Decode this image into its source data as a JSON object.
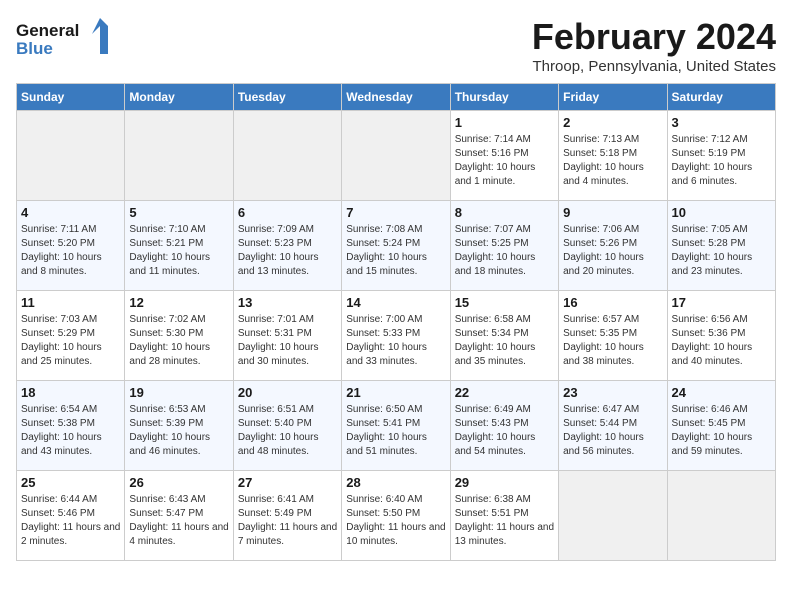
{
  "header": {
    "logo_line1": "General",
    "logo_line2": "Blue",
    "month_title": "February 2024",
    "location": "Throop, Pennsylvania, United States"
  },
  "weekdays": [
    "Sunday",
    "Monday",
    "Tuesday",
    "Wednesday",
    "Thursday",
    "Friday",
    "Saturday"
  ],
  "weeks": [
    [
      {
        "day": "",
        "sunrise": "",
        "sunset": "",
        "daylight": "",
        "empty": true
      },
      {
        "day": "",
        "sunrise": "",
        "sunset": "",
        "daylight": "",
        "empty": true
      },
      {
        "day": "",
        "sunrise": "",
        "sunset": "",
        "daylight": "",
        "empty": true
      },
      {
        "day": "",
        "sunrise": "",
        "sunset": "",
        "daylight": "",
        "empty": true
      },
      {
        "day": "1",
        "sunrise": "Sunrise: 7:14 AM",
        "sunset": "Sunset: 5:16 PM",
        "daylight": "Daylight: 10 hours and 1 minute.",
        "empty": false
      },
      {
        "day": "2",
        "sunrise": "Sunrise: 7:13 AM",
        "sunset": "Sunset: 5:18 PM",
        "daylight": "Daylight: 10 hours and 4 minutes.",
        "empty": false
      },
      {
        "day": "3",
        "sunrise": "Sunrise: 7:12 AM",
        "sunset": "Sunset: 5:19 PM",
        "daylight": "Daylight: 10 hours and 6 minutes.",
        "empty": false
      }
    ],
    [
      {
        "day": "4",
        "sunrise": "Sunrise: 7:11 AM",
        "sunset": "Sunset: 5:20 PM",
        "daylight": "Daylight: 10 hours and 8 minutes.",
        "empty": false
      },
      {
        "day": "5",
        "sunrise": "Sunrise: 7:10 AM",
        "sunset": "Sunset: 5:21 PM",
        "daylight": "Daylight: 10 hours and 11 minutes.",
        "empty": false
      },
      {
        "day": "6",
        "sunrise": "Sunrise: 7:09 AM",
        "sunset": "Sunset: 5:23 PM",
        "daylight": "Daylight: 10 hours and 13 minutes.",
        "empty": false
      },
      {
        "day": "7",
        "sunrise": "Sunrise: 7:08 AM",
        "sunset": "Sunset: 5:24 PM",
        "daylight": "Daylight: 10 hours and 15 minutes.",
        "empty": false
      },
      {
        "day": "8",
        "sunrise": "Sunrise: 7:07 AM",
        "sunset": "Sunset: 5:25 PM",
        "daylight": "Daylight: 10 hours and 18 minutes.",
        "empty": false
      },
      {
        "day": "9",
        "sunrise": "Sunrise: 7:06 AM",
        "sunset": "Sunset: 5:26 PM",
        "daylight": "Daylight: 10 hours and 20 minutes.",
        "empty": false
      },
      {
        "day": "10",
        "sunrise": "Sunrise: 7:05 AM",
        "sunset": "Sunset: 5:28 PM",
        "daylight": "Daylight: 10 hours and 23 minutes.",
        "empty": false
      }
    ],
    [
      {
        "day": "11",
        "sunrise": "Sunrise: 7:03 AM",
        "sunset": "Sunset: 5:29 PM",
        "daylight": "Daylight: 10 hours and 25 minutes.",
        "empty": false
      },
      {
        "day": "12",
        "sunrise": "Sunrise: 7:02 AM",
        "sunset": "Sunset: 5:30 PM",
        "daylight": "Daylight: 10 hours and 28 minutes.",
        "empty": false
      },
      {
        "day": "13",
        "sunrise": "Sunrise: 7:01 AM",
        "sunset": "Sunset: 5:31 PM",
        "daylight": "Daylight: 10 hours and 30 minutes.",
        "empty": false
      },
      {
        "day": "14",
        "sunrise": "Sunrise: 7:00 AM",
        "sunset": "Sunset: 5:33 PM",
        "daylight": "Daylight: 10 hours and 33 minutes.",
        "empty": false
      },
      {
        "day": "15",
        "sunrise": "Sunrise: 6:58 AM",
        "sunset": "Sunset: 5:34 PM",
        "daylight": "Daylight: 10 hours and 35 minutes.",
        "empty": false
      },
      {
        "day": "16",
        "sunrise": "Sunrise: 6:57 AM",
        "sunset": "Sunset: 5:35 PM",
        "daylight": "Daylight: 10 hours and 38 minutes.",
        "empty": false
      },
      {
        "day": "17",
        "sunrise": "Sunrise: 6:56 AM",
        "sunset": "Sunset: 5:36 PM",
        "daylight": "Daylight: 10 hours and 40 minutes.",
        "empty": false
      }
    ],
    [
      {
        "day": "18",
        "sunrise": "Sunrise: 6:54 AM",
        "sunset": "Sunset: 5:38 PM",
        "daylight": "Daylight: 10 hours and 43 minutes.",
        "empty": false
      },
      {
        "day": "19",
        "sunrise": "Sunrise: 6:53 AM",
        "sunset": "Sunset: 5:39 PM",
        "daylight": "Daylight: 10 hours and 46 minutes.",
        "empty": false
      },
      {
        "day": "20",
        "sunrise": "Sunrise: 6:51 AM",
        "sunset": "Sunset: 5:40 PM",
        "daylight": "Daylight: 10 hours and 48 minutes.",
        "empty": false
      },
      {
        "day": "21",
        "sunrise": "Sunrise: 6:50 AM",
        "sunset": "Sunset: 5:41 PM",
        "daylight": "Daylight: 10 hours and 51 minutes.",
        "empty": false
      },
      {
        "day": "22",
        "sunrise": "Sunrise: 6:49 AM",
        "sunset": "Sunset: 5:43 PM",
        "daylight": "Daylight: 10 hours and 54 minutes.",
        "empty": false
      },
      {
        "day": "23",
        "sunrise": "Sunrise: 6:47 AM",
        "sunset": "Sunset: 5:44 PM",
        "daylight": "Daylight: 10 hours and 56 minutes.",
        "empty": false
      },
      {
        "day": "24",
        "sunrise": "Sunrise: 6:46 AM",
        "sunset": "Sunset: 5:45 PM",
        "daylight": "Daylight: 10 hours and 59 minutes.",
        "empty": false
      }
    ],
    [
      {
        "day": "25",
        "sunrise": "Sunrise: 6:44 AM",
        "sunset": "Sunset: 5:46 PM",
        "daylight": "Daylight: 11 hours and 2 minutes.",
        "empty": false
      },
      {
        "day": "26",
        "sunrise": "Sunrise: 6:43 AM",
        "sunset": "Sunset: 5:47 PM",
        "daylight": "Daylight: 11 hours and 4 minutes.",
        "empty": false
      },
      {
        "day": "27",
        "sunrise": "Sunrise: 6:41 AM",
        "sunset": "Sunset: 5:49 PM",
        "daylight": "Daylight: 11 hours and 7 minutes.",
        "empty": false
      },
      {
        "day": "28",
        "sunrise": "Sunrise: 6:40 AM",
        "sunset": "Sunset: 5:50 PM",
        "daylight": "Daylight: 11 hours and 10 minutes.",
        "empty": false
      },
      {
        "day": "29",
        "sunrise": "Sunrise: 6:38 AM",
        "sunset": "Sunset: 5:51 PM",
        "daylight": "Daylight: 11 hours and 13 minutes.",
        "empty": false
      },
      {
        "day": "",
        "sunrise": "",
        "sunset": "",
        "daylight": "",
        "empty": true
      },
      {
        "day": "",
        "sunrise": "",
        "sunset": "",
        "daylight": "",
        "empty": true
      }
    ]
  ]
}
